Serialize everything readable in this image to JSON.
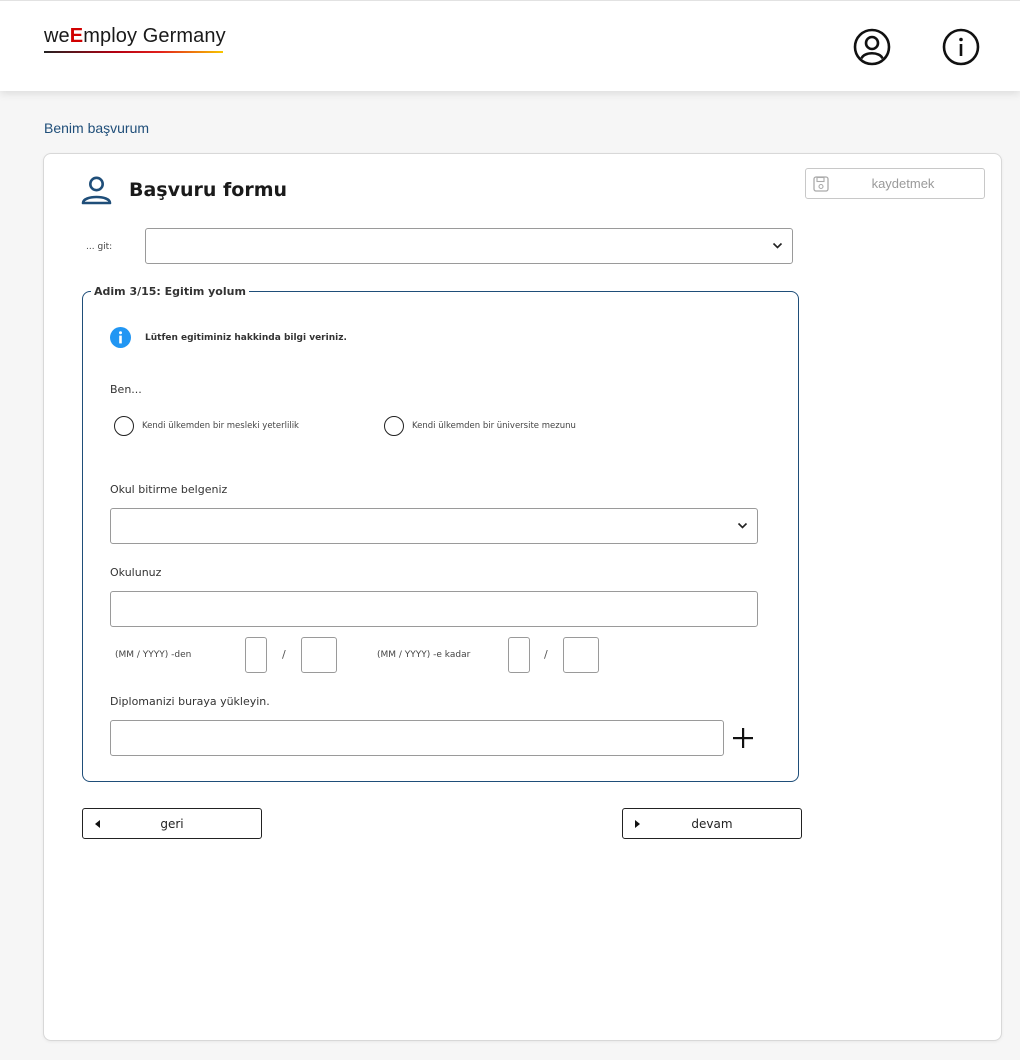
{
  "header": {
    "logo": {
      "part1": "we",
      "part2": "E",
      "part3": "mploy",
      "part4": " Germany"
    },
    "icons": [
      "user-account-icon",
      "info-icon"
    ]
  },
  "breadcrumb": "Benim başvurum",
  "form": {
    "title": "Başvuru formu",
    "save_label": "kaydetmek",
    "goto_label": "... git:",
    "goto_value": "",
    "step": {
      "legend": "Adim 3/15: Egitim yolum",
      "info": "Lütfen egitiminiz hakkinda bilgi veriniz.",
      "ben": "Ben...",
      "options": [
        "Kendi ülkemden bir mesleki yeterlilik",
        "Kendi ülkemden bir üniversite mezunu"
      ],
      "school_cert_label": "Okul bitirme belgeniz",
      "school_cert_value": "",
      "school_label": "Okulunuz",
      "school_value": "",
      "from_label": "(MM / YYYY) -den",
      "to_label": "(MM / YYYY) -e kadar",
      "date_separator": "/",
      "diploma_label": "Diplomanizi buraya yükleyin.",
      "diploma_value": ""
    },
    "back_label": "geri",
    "next_label": "devam"
  },
  "colors": {
    "accent": "#1f4e79",
    "info_blue": "#2196f3",
    "logo_red": "#d10000"
  }
}
